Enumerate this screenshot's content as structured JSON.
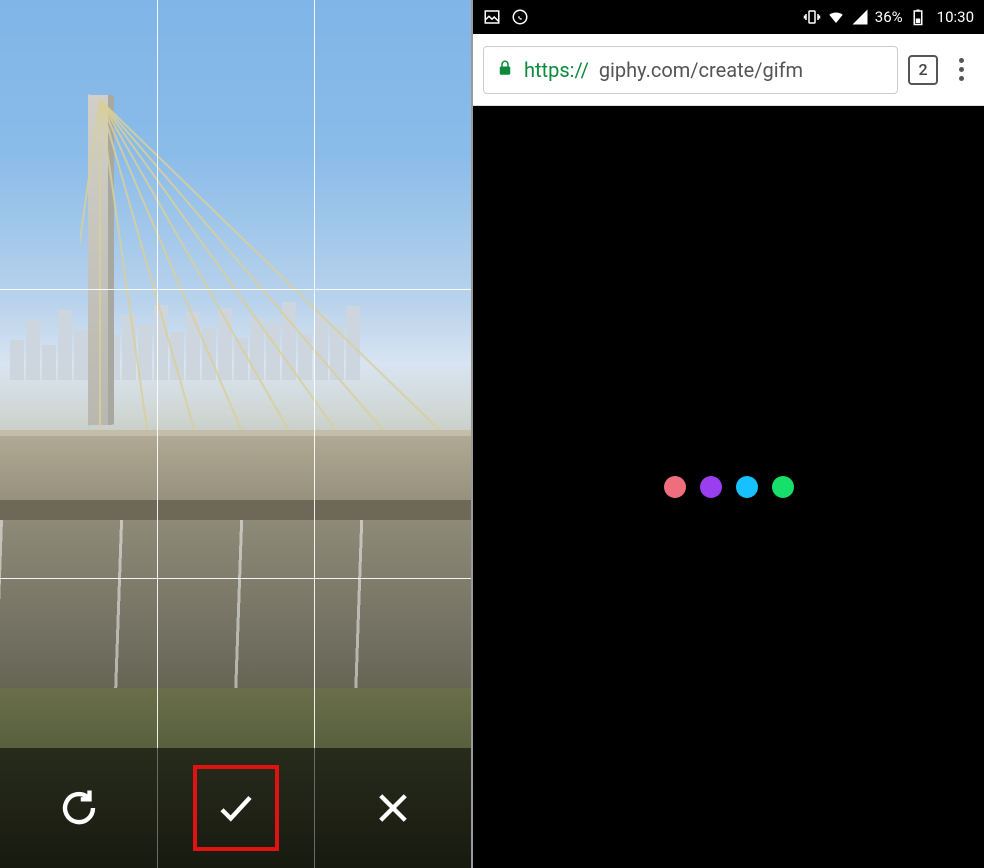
{
  "left": {
    "toolbar": {
      "rotate_icon": "rotate-icon",
      "confirm_icon": "check-icon",
      "cancel_icon": "close-icon"
    },
    "highlighted_action": "confirm"
  },
  "right": {
    "statusbar": {
      "battery_text": "36%",
      "clock": "10:30",
      "left_icons": [
        "photo-icon",
        "whatsapp-icon"
      ],
      "right_icons": [
        "vibrate-icon",
        "wifi-icon",
        "signal-icon"
      ]
    },
    "chrome": {
      "scheme": "https://",
      "url_rest": "giphy.com/create/gifm",
      "tab_count": "2"
    },
    "loader_colors": [
      "#ef6e7e",
      "#9a3ef0",
      "#17c0ff",
      "#16e06a"
    ]
  }
}
